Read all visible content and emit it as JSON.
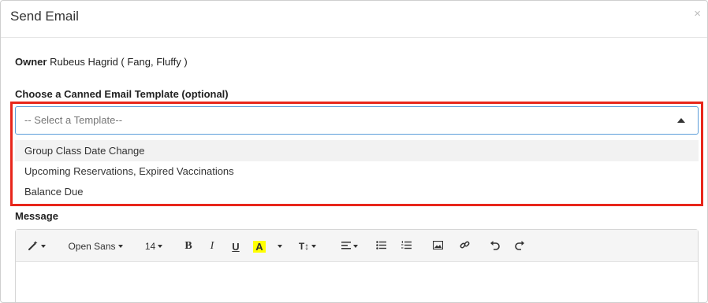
{
  "modal": {
    "title": "Send Email",
    "close_label": "×"
  },
  "owner": {
    "label": "Owner",
    "value": "Rubeus Hagrid ( Fang, Fluffy )"
  },
  "template": {
    "label": "Choose a Canned Email Template (optional)",
    "placeholder": "-- Select a Template--",
    "options": [
      "Group Class Date Change",
      "Upcoming Reservations, Expired Vaccinations",
      "Balance Due"
    ]
  },
  "message": {
    "label": "Message"
  },
  "toolbar": {
    "font_family": "Open Sans",
    "font_size": "14",
    "bold": "B",
    "italic": "I",
    "underline": "U",
    "highlight": "A",
    "line_height": "T↕",
    "highlight_color": "#ffff00",
    "icons": [
      "magic-wand-icon",
      "align-icon",
      "bullet-list-icon",
      "numbered-list-icon",
      "image-icon",
      "link-icon",
      "undo-icon",
      "redo-icon"
    ]
  },
  "colors": {
    "highlight_border": "#e8261b",
    "focus_border": "#5b9dd9"
  }
}
